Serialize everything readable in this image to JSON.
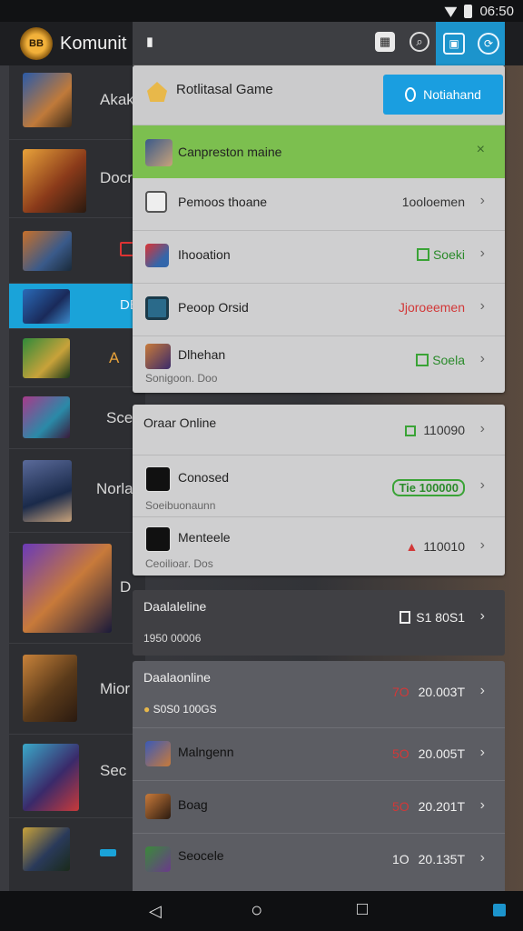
{
  "status_bar": {
    "time": "06:50",
    "wifi_icon": "wifi-icon",
    "battery_icon": "battery-icon"
  },
  "app": {
    "title": "Komunit",
    "logo_text": "BB"
  },
  "left_list": [
    {
      "label": "Akak"
    },
    {
      "label": "Docr"
    },
    {
      "label": ""
    },
    {
      "label": "DE"
    },
    {
      "label": "A"
    },
    {
      "label": "Sce"
    },
    {
      "label": "Norla"
    },
    {
      "label": "D"
    },
    {
      "label": "Mior"
    },
    {
      "label": "Sec"
    },
    {
      "label": ""
    }
  ],
  "panel": {
    "header": {
      "title": "Rotlitasal Game",
      "action_button": "Notiahand"
    },
    "notification": {
      "label": "Canpreston maine",
      "close": "×"
    },
    "rows1": [
      {
        "label": "Pemoos thoane",
        "value": "1ooloemen",
        "chevron": "›"
      },
      {
        "label": "Ihooation",
        "value": "Soeki",
        "chevron": "›"
      },
      {
        "label": "Peoop Orsid",
        "value": "Jjoroeemen",
        "chevron": "›"
      },
      {
        "label": "Dlhehan",
        "sub": "Sonigoon. Doo",
        "value": "Soela",
        "chevron": "›"
      }
    ],
    "section2": {
      "title": "Oraar Online",
      "title_value": "110090",
      "rows": [
        {
          "label": "Conosed",
          "sub": "Soeibuonaunn",
          "value": "Tie  100000",
          "chevron": "›"
        },
        {
          "label": "Menteele",
          "sub": "Ceoilioar. Dos",
          "value": "110010",
          "chevron": "›"
        }
      ]
    },
    "section3": {
      "title": "Daalaleline",
      "sub": "1950 00006",
      "value": "S1 80S1",
      "chevron": "›"
    },
    "section4": {
      "title": "Daalaonline",
      "sub": "S0S0 100GS",
      "value_red": "7O",
      "value": "20.003T",
      "rows": [
        {
          "label": "Malngenn",
          "value_red": "5O",
          "value": "20.005T",
          "chevron": "›"
        },
        {
          "label": "Boag",
          "value_red": "5O",
          "value": "20.201T",
          "chevron": "›"
        },
        {
          "label": "Seocele",
          "value_red": "1O",
          "value": "20.135T",
          "chevron": "›"
        }
      ]
    }
  },
  "nav": {
    "back": "◁",
    "home": "○",
    "recents": "□"
  },
  "colors": {
    "accent_blue": "#1aa3d9",
    "notify_green": "#7cbf4f",
    "value_red": "#d23838",
    "value_green": "#3aa336"
  }
}
